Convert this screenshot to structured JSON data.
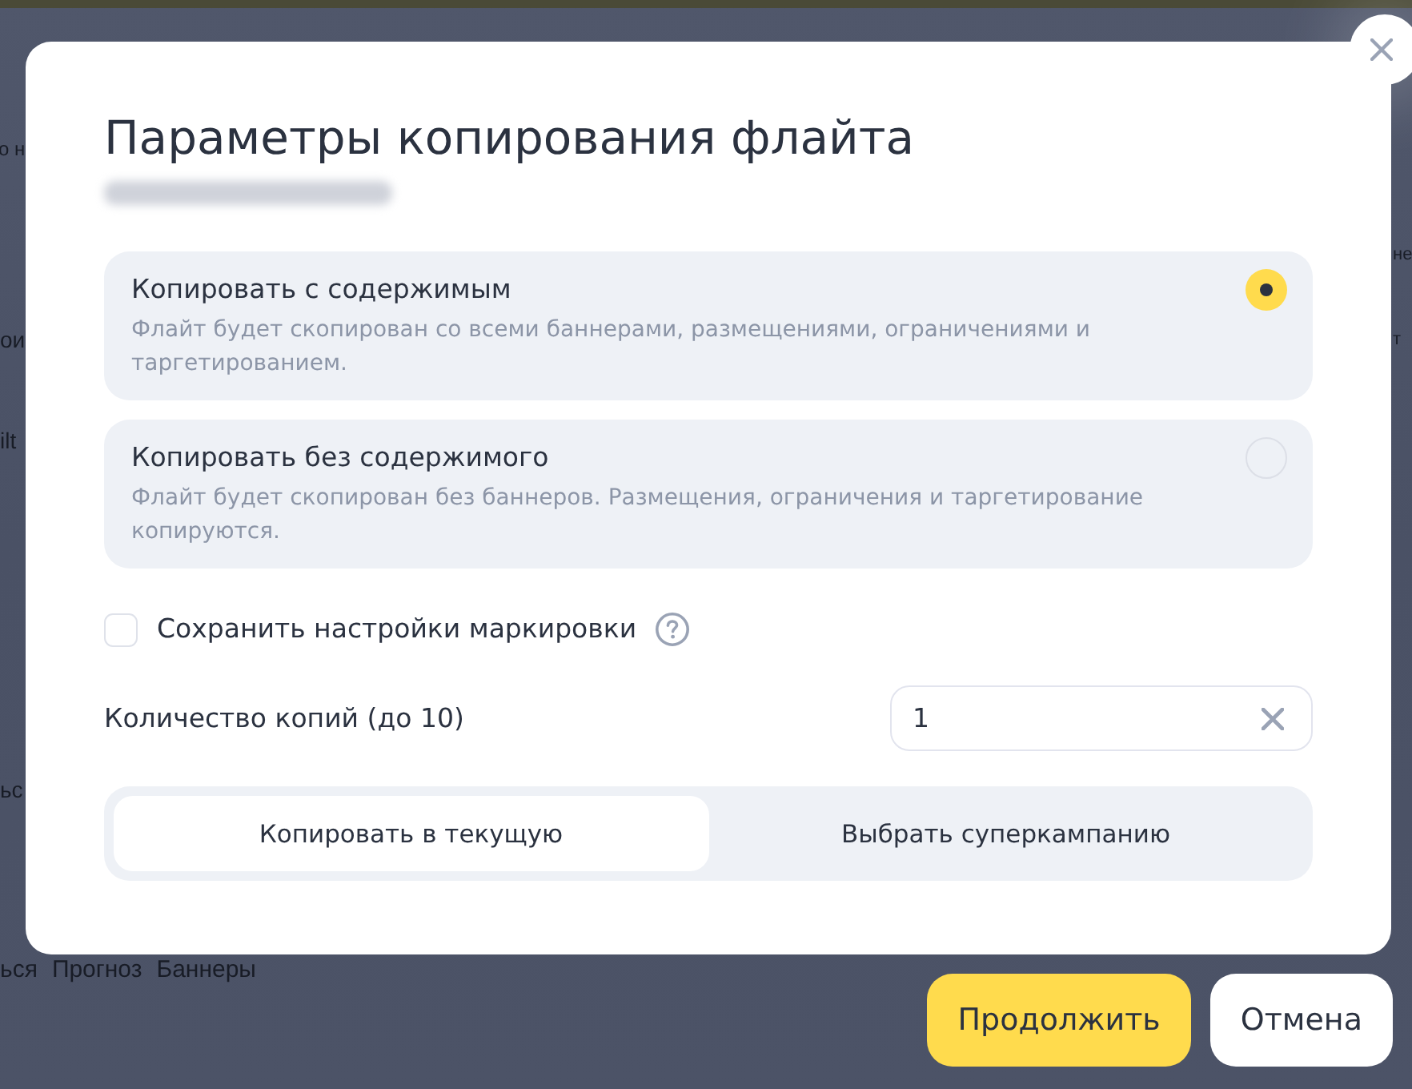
{
  "background": {
    "left_column": [
      "о н",
      "ои",
      "ilt",
      "ьс"
    ],
    "right_column": [
      "не",
      "т"
    ],
    "tabs": [
      "ься",
      "Прогноз",
      "Баннеры"
    ]
  },
  "dialog": {
    "title": "Параметры копирования флайта",
    "options": [
      {
        "title": "Копировать с содержимым",
        "description": "Флайт будет скопирован со всеми баннерами, размещениями, ограничениями и таргетированием.",
        "selected": true
      },
      {
        "title": "Копировать без содержимого",
        "description": "Флайт будет скопирован без баннеров. Размещения, ограничения и таргетирование копируются.",
        "selected": false
      }
    ],
    "marking": {
      "label": "Сохранить настройки маркировки",
      "checked": false
    },
    "copies": {
      "label": "Количество копий (до 10)",
      "value": "1"
    },
    "segments": [
      {
        "label": "Копировать в текущую",
        "selected": true
      },
      {
        "label": "Выбрать суперкампанию",
        "selected": false
      }
    ]
  },
  "buttons": [
    {
      "label": "Продолжить",
      "kind": "primary"
    },
    {
      "label": "Отмена",
      "kind": "secondary"
    }
  ]
}
